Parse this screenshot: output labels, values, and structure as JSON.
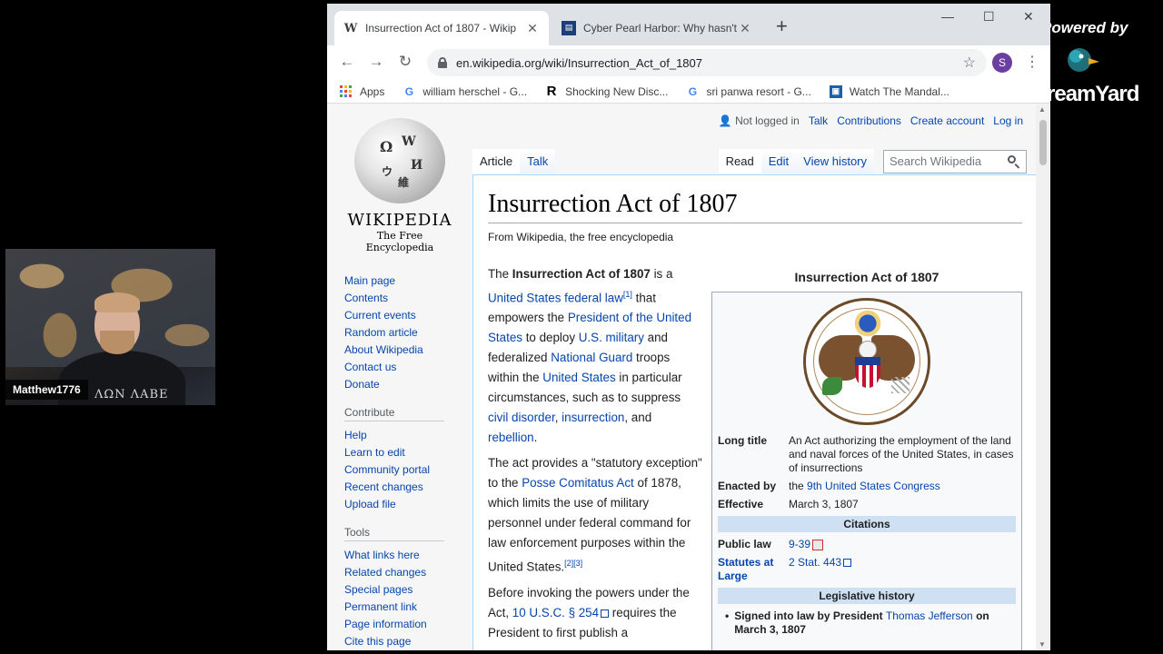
{
  "webcam": {
    "name": "Matthew1776",
    "shirt_text": "ΛΩΝ ΛΑΒΕ"
  },
  "overlay": {
    "powered_by": "Powered by",
    "brand": "StreamYard"
  },
  "browser": {
    "tabs": [
      {
        "title": "Insurrection Act of 1807 - Wikip",
        "favicon": "W",
        "active": true
      },
      {
        "title": "Cyber Pearl Harbor: Why hasn't a",
        "favicon": "news-icon",
        "active": false
      }
    ],
    "url": "en.wikipedia.org/wiki/Insurrection_Act_of_1807",
    "profile_initial": "S",
    "bookmarks": [
      {
        "label": "Apps",
        "icon": "apps-grid-icon"
      },
      {
        "label": "william herschel - G...",
        "icon": "google-icon"
      },
      {
        "label": "Shocking New Disc...",
        "icon": "R"
      },
      {
        "label": "sri panwa resort - G...",
        "icon": "google-icon"
      },
      {
        "label": "Watch The Mandal...",
        "icon": "bookmark-icon"
      }
    ]
  },
  "wiki": {
    "personal": {
      "not_logged_in": "Not logged in",
      "talk": "Talk",
      "contributions": "Contributions",
      "create_account": "Create account",
      "log_in": "Log in"
    },
    "wordmark": "WIKIPEDIA",
    "tagline": "The Free Encyclopedia",
    "nav": [
      "Main page",
      "Contents",
      "Current events",
      "Random article",
      "About Wikipedia",
      "Contact us",
      "Donate"
    ],
    "contribute_heading": "Contribute",
    "contribute": [
      "Help",
      "Learn to edit",
      "Community portal",
      "Recent changes",
      "Upload file"
    ],
    "tools_heading": "Tools",
    "tools": [
      "What links here",
      "Related changes",
      "Special pages",
      "Permanent link",
      "Page information",
      "Cite this page"
    ],
    "tabs_left": [
      "Article",
      "Talk"
    ],
    "tabs_right": [
      "Read",
      "Edit",
      "View history"
    ],
    "search_placeholder": "Search Wikipedia",
    "title": "Insurrection Act of 1807",
    "site_sub": "From Wikipedia, the free encyclopedia",
    "para1": {
      "t1": "The ",
      "bold": "Insurrection Act of 1807",
      "t2": " is a ",
      "l1": "United States federal law",
      "ref1": "[1]",
      "t3": " that empowers the ",
      "l2": "President of the United States",
      "t4": " to deploy ",
      "l3": "U.S. military",
      "t5": " and federalized ",
      "l4": "National Guard",
      "t6": " troops within the ",
      "l5": "United States",
      "t7": " in particular circumstances, such as to suppress ",
      "l6": "civil disorder",
      "t8": ", ",
      "l7": "insurrection",
      "t9": ", and ",
      "l8": "rebellion",
      "t10": "."
    },
    "para2": {
      "t1": "The act provides a \"statutory exception\" to the ",
      "l1": "Posse Comitatus Act",
      "t2": " of 1878, which limits the use of military personnel under federal command for law enforcement purposes within the United States.",
      "ref": "[2][3]"
    },
    "para3": {
      "t1": "Before invoking the powers under the Act, ",
      "l1": "10 U.S.C. § 254",
      "t2": " requires the President to first publish a"
    },
    "infobox": {
      "title": "Insurrection Act of 1807",
      "long_title_label": "Long title",
      "long_title": "An Act authorizing the employment of the land and naval forces of the United States, in cases of insurrections",
      "enacted_label": "Enacted by",
      "enacted_t": "the ",
      "enacted_link": "9th United States Congress",
      "effective_label": "Effective",
      "effective": "March 3, 1807",
      "citations_header": "Citations",
      "public_law_label": "Public law",
      "public_law": "9-39",
      "statutes_label": "Statutes at Large",
      "statutes": "2 Stat. 443",
      "legislative_header": "Legislative history",
      "signed_t1": "Signed into law by President ",
      "signed_link": "Thomas Jefferson",
      "signed_t2": " on March 3, 1807"
    }
  }
}
